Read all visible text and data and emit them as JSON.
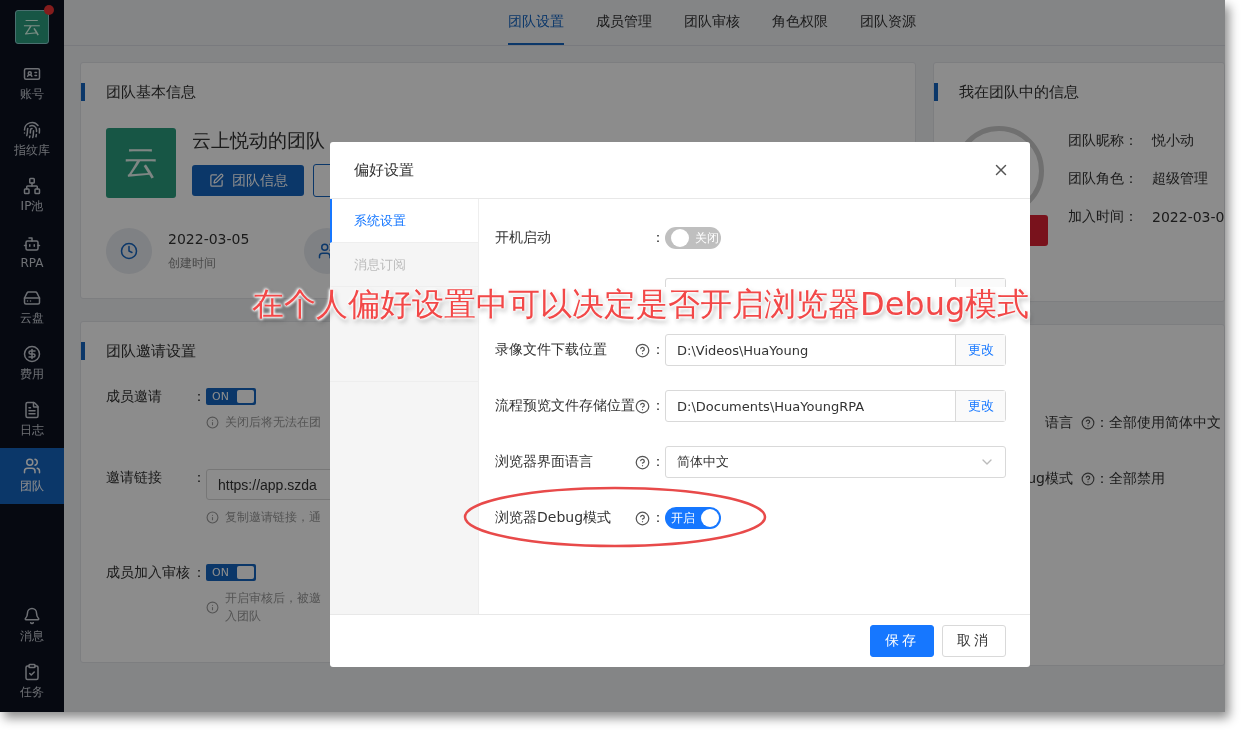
{
  "sidebar": {
    "logo": "云",
    "has_notification": true,
    "items": [
      {
        "label": "账号",
        "selected": false
      },
      {
        "label": "指纹库",
        "selected": false
      },
      {
        "label": "IP池",
        "selected": false
      },
      {
        "label": "RPA",
        "selected": false
      },
      {
        "label": "云盘",
        "selected": false
      },
      {
        "label": "费用",
        "selected": false
      },
      {
        "label": "日志",
        "selected": false
      },
      {
        "label": "团队",
        "selected": true
      }
    ],
    "bottom_items": [
      {
        "label": "消息"
      },
      {
        "label": "任务"
      }
    ]
  },
  "top_tabs": [
    {
      "label": "团队设置",
      "selected": true
    },
    {
      "label": "成员管理",
      "selected": false
    },
    {
      "label": "团队审核",
      "selected": false
    },
    {
      "label": "角色权限",
      "selected": false
    },
    {
      "label": "团队资源",
      "selected": false
    }
  ],
  "team_info": {
    "title": "团队基本信息",
    "logo": "云",
    "name": "云上悦动的团队",
    "edit_button": "团队信息",
    "stats": [
      {
        "value": "2022-03-05",
        "caption": "创建时间"
      }
    ]
  },
  "invite_settings": {
    "title": "团队邀请设置",
    "rows": [
      {
        "kind": "toggle",
        "label": "成员邀请",
        "colon": "：",
        "on": true,
        "switch_text": "ON",
        "hint": [
          "关闭后将无法在团"
        ]
      },
      {
        "kind": "link",
        "label": "邀请链接",
        "colon": "：",
        "value": "https://app.szda",
        "hint": [
          "复制邀请链接，通"
        ]
      },
      {
        "kind": "toggle",
        "label": "成员加入审核",
        "colon": "：",
        "on": true,
        "switch_text": "ON",
        "hint": [
          "开启审核后，被邀",
          "入团队"
        ]
      }
    ]
  },
  "my_info": {
    "title": "我在团队中的信息",
    "fields": [
      {
        "label": "团队昵称：",
        "value": "悦小动"
      },
      {
        "label": "团队角色：",
        "value": "超级管理"
      },
      {
        "label": "加入时间：",
        "value": "2022-03-0"
      }
    ],
    "policies": [
      {
        "label": "语言",
        "colon": "：",
        "value": "全部使用简体中文"
      },
      {
        "label": "ug模式",
        "colon": "：",
        "value": "全部禁用"
      }
    ]
  },
  "dialog": {
    "title": "偏好设置",
    "nav": [
      {
        "label": "系统设置",
        "selected": true
      },
      {
        "label": "消息订阅",
        "selected": false
      }
    ],
    "rows": [
      {
        "kind": "toggle",
        "label": "开机启动",
        "help": false,
        "colon": "：",
        "on": false,
        "switch_text": "关闭"
      },
      {
        "kind": "path",
        "help": false
      },
      {
        "kind": "path",
        "label": "录像文件下载位置",
        "help": true,
        "colon": "：",
        "value": "D:\\Videos\\HuaYoung",
        "button": "更改"
      },
      {
        "kind": "path",
        "label": "流程预览文件存储位置",
        "help": true,
        "colon": "：",
        "value": "D:\\Documents\\HuaYoungRPA",
        "button": "更改"
      },
      {
        "kind": "select",
        "label": "浏览器界面语言",
        "help": true,
        "colon": "：",
        "value": "简体中文"
      },
      {
        "kind": "toggle",
        "label": "浏览器Debug模式",
        "help": true,
        "colon": "：",
        "on": true,
        "switch_text": "开启",
        "highlighted": true
      }
    ],
    "buttons": [
      {
        "label": "保存",
        "primary": true
      },
      {
        "label": "取消",
        "primary": false
      }
    ]
  },
  "annotation": "在个人偏好设置中可以决定是否开启浏览器Debug模式"
}
